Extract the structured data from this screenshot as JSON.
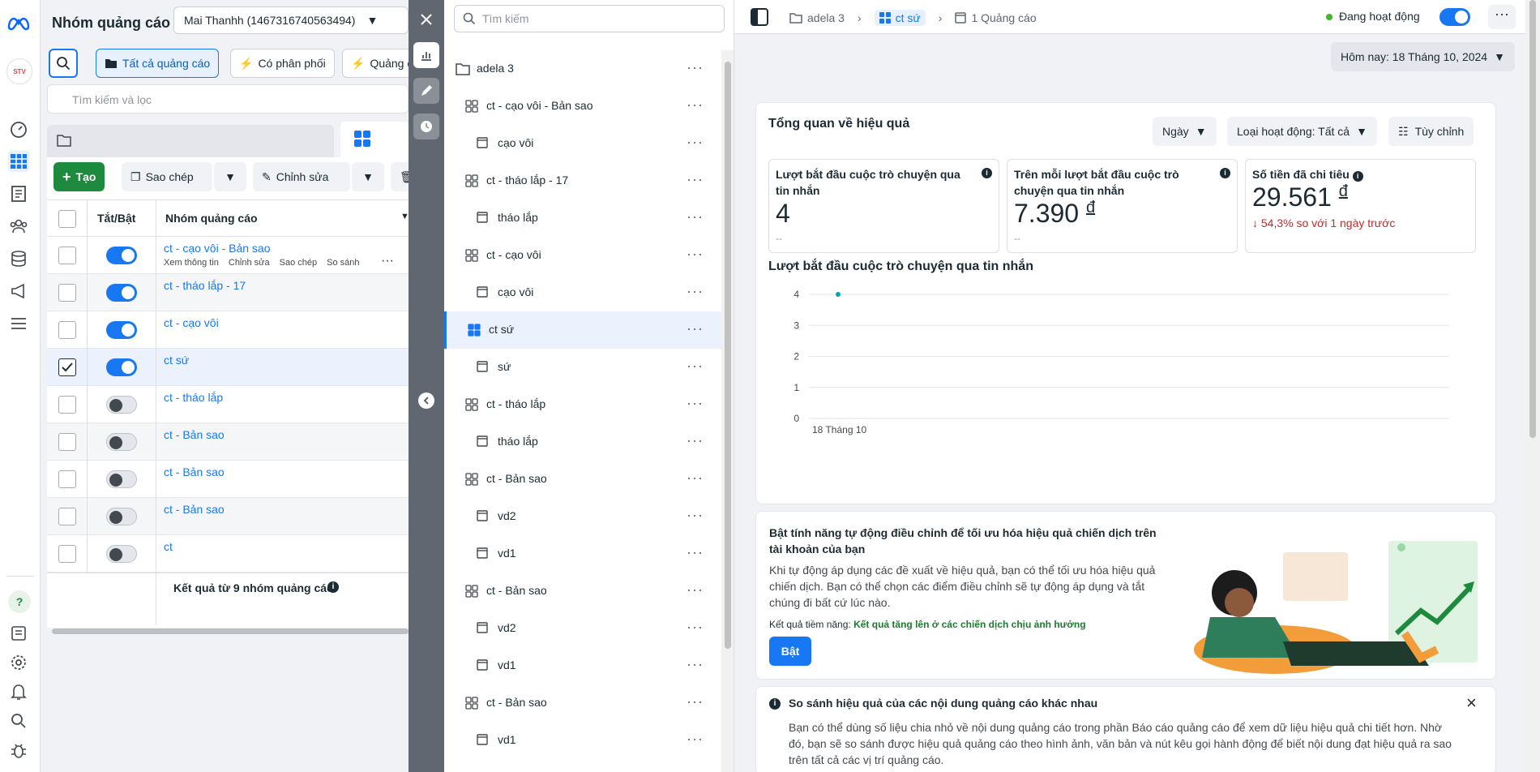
{
  "leftnav": {
    "items": [
      "meta-logo",
      "account-avatar",
      "gauge-icon",
      "table-icon",
      "document-icon",
      "people-icon",
      "database-icon",
      "megaphone-icon",
      "menu-icon"
    ],
    "bottom": [
      "help-icon",
      "notes-icon",
      "settings-icon",
      "bell-icon",
      "search-icon",
      "bug-icon"
    ]
  },
  "adsmgr": {
    "title": "Nhóm quảng cáo",
    "account": "Mai Thanhh (1467316740563494)",
    "filters": {
      "all": "Tất cả quảng cáo",
      "delivery": "Có phân phối",
      "ads": "Quảng c"
    },
    "search_placeholder": "Tìm kiếm và lọc",
    "create": "Tạo",
    "copy": "Sao chép",
    "edit": "Chỉnh sửa",
    "col_toggle": "Tắt/Bật",
    "col_name": "Nhóm quảng cáo",
    "rows": [
      {
        "name": "ct - cạo vôi - Bản sao",
        "on": true,
        "checked": false
      },
      {
        "name": "ct - tháo lắp - 17",
        "on": true,
        "checked": false
      },
      {
        "name": "ct - cạo vôi",
        "on": true,
        "checked": false
      },
      {
        "name": "ct sứ",
        "on": true,
        "checked": true
      },
      {
        "name": "ct - tháo lắp",
        "on": false,
        "checked": false
      },
      {
        "name": "ct - Bản sao",
        "on": false,
        "checked": false
      },
      {
        "name": "ct - Bản sao",
        "on": false,
        "checked": false
      },
      {
        "name": "ct - Bản sao",
        "on": false,
        "checked": false
      },
      {
        "name": "ct",
        "on": false,
        "checked": false
      }
    ],
    "row_actions": [
      "Xem thông tin",
      "Chỉnh sửa",
      "Sao chép",
      "So sánh"
    ],
    "summary": "Kết quả từ 9 nhóm quảng cáo"
  },
  "tree": {
    "search_placeholder": "Tìm kiếm",
    "items": [
      {
        "label": "adela 3",
        "level": 0,
        "kind": "folder"
      },
      {
        "label": "ct - cạo vôi - Bản sao",
        "level": 1,
        "kind": "grid"
      },
      {
        "label": "cạo vôi",
        "level": 2,
        "kind": "ad"
      },
      {
        "label": "ct - tháo lắp - 17",
        "level": 1,
        "kind": "grid"
      },
      {
        "label": "tháo lắp",
        "level": 2,
        "kind": "ad"
      },
      {
        "label": "ct - cạo vôi",
        "level": 1,
        "kind": "grid"
      },
      {
        "label": "cạo vôi",
        "level": 2,
        "kind": "ad"
      },
      {
        "label": "ct sứ",
        "level": 1,
        "kind": "grid",
        "selected": true
      },
      {
        "label": "sứ",
        "level": 2,
        "kind": "ad"
      },
      {
        "label": "ct - tháo lắp",
        "level": 1,
        "kind": "grid"
      },
      {
        "label": "tháo lắp",
        "level": 2,
        "kind": "ad"
      },
      {
        "label": "ct - Bản sao",
        "level": 1,
        "kind": "grid"
      },
      {
        "label": "vd2",
        "level": 2,
        "kind": "ad"
      },
      {
        "label": "vd1",
        "level": 2,
        "kind": "ad"
      },
      {
        "label": "ct - Bản sao",
        "level": 1,
        "kind": "grid"
      },
      {
        "label": "vd2",
        "level": 2,
        "kind": "ad"
      },
      {
        "label": "vd1",
        "level": 2,
        "kind": "ad"
      },
      {
        "label": "ct - Bản sao",
        "level": 1,
        "kind": "grid"
      },
      {
        "label": "vd1",
        "level": 2,
        "kind": "ad"
      }
    ]
  },
  "main": {
    "breadcrumb": {
      "campaign": "adela 3",
      "adset": "ct sứ",
      "ads": "1 Quảng cáo"
    },
    "status": "Đang hoạt động",
    "date": "Hôm nay: 18 Tháng 10, 2024",
    "overview": {
      "title": "Tổng quan về hiệu quả",
      "period": "Ngày",
      "activity": "Loại hoạt động: Tất cả",
      "customize": "Tùy chỉnh",
      "metrics": [
        {
          "label": "Lượt bắt đầu cuộc trò chuyện qua tin nhắn",
          "value": "4",
          "sub": "--"
        },
        {
          "label": "Trên mỗi lượt bắt đầu cuộc trò chuyện qua tin nhắn",
          "value": "7.390",
          "currency": "đ",
          "sub": "--"
        },
        {
          "label": "Số tiền đã chi tiêu",
          "value": "29.561",
          "currency": "đ",
          "sub": "54,3% so với 1 ngày trước"
        }
      ],
      "chart_title": "Lượt bắt đầu cuộc trò chuyện qua tin nhắn"
    },
    "promo": {
      "title": "Bật tính năng tự động điều chỉnh để tối ưu hóa hiệu quả chiến dịch trên tài khoản của bạn",
      "body": "Khi tự động áp dụng các đề xuất về hiệu quả, bạn có thể tối ưu hóa hiệu quả chiến dịch. Bạn có thể chọn các điểm điều chỉnh sẽ tự động áp dụng và tắt chúng đi bất cứ lúc nào.",
      "potential_label": "Kết quả tiềm năng:",
      "potential_value": "Kết quả tăng lên ở các chiến dịch chịu ảnh hưởng",
      "button": "Bật"
    },
    "notice": {
      "title": "So sánh hiệu quả của các nội dung quảng cáo khác nhau",
      "body": "Bạn có thể dùng số liệu chia nhỏ về nội dung quảng cáo trong phần Báo cáo quảng cáo để xem dữ liệu hiệu quả chi tiết hơn. Nhờ đó, bạn sẽ so sánh được hiệu quả quảng cáo theo hình ảnh, văn bản và nút kêu gọi hành động để biết nội dung đạt hiệu quả ra sao trên tất cả các vị trí quảng cáo."
    }
  },
  "chart_data": {
    "type": "line",
    "title": "Lượt bắt đầu cuộc trò chuyện qua tin nhắn",
    "categories": [
      "18 Tháng 10"
    ],
    "values": [
      4
    ],
    "ylim": [
      0,
      4
    ],
    "yticks": [
      "0",
      "1",
      "2",
      "3",
      "4"
    ],
    "color": "#00a8b5",
    "grid": true
  }
}
